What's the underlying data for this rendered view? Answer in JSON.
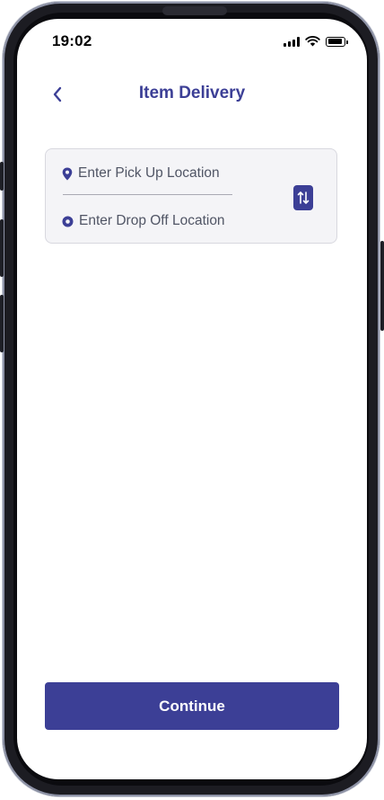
{
  "status_bar": {
    "time": "19:02",
    "signal_icon": "cellular-signal-icon",
    "wifi_icon": "wifi-icon",
    "battery_icon": "battery-icon"
  },
  "header": {
    "back_icon": "chevron-left-icon",
    "title": "Item Delivery"
  },
  "location_card": {
    "pickup_icon": "map-pin-icon",
    "pickup_placeholder": "Enter Pick Up Location",
    "dropoff_icon": "target-dot-icon",
    "dropoff_placeholder": "Enter Drop Off Location",
    "swap_icon": "swap-vertical-icon"
  },
  "footer": {
    "continue_label": "Continue"
  },
  "colors": {
    "primary": "#3c3f96",
    "card_bg": "#f4f4f7",
    "card_border": "#d8d8df",
    "placeholder_text": "#505565"
  }
}
